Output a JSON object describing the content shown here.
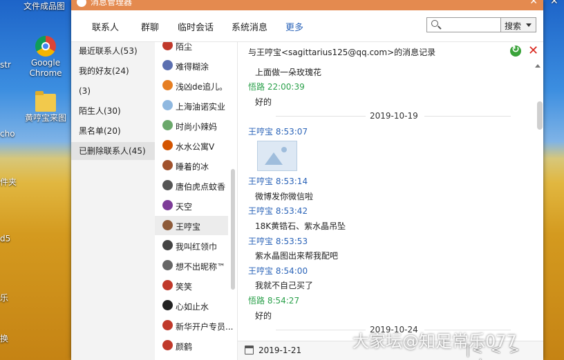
{
  "desktop": {
    "icons": [
      {
        "label": "文件成品图"
      },
      {
        "label": "Google Chrome"
      },
      {
        "label": "黄哼宝来图"
      }
    ],
    "edge_labels": [
      "str",
      "cho",
      "件夹",
      "d5",
      "乐",
      "换"
    ]
  },
  "window": {
    "title": "消息管理器",
    "tabs": [
      {
        "label": "联系人"
      },
      {
        "label": "群聊"
      },
      {
        "label": "临时会话"
      },
      {
        "label": "系统消息"
      },
      {
        "label": "更多"
      }
    ],
    "search": {
      "placeholder": "",
      "button_label": "搜索"
    }
  },
  "categories": [
    {
      "label": "最近联系人(53)"
    },
    {
      "label": "我的好友(24)"
    },
    {
      "label": "(3)"
    },
    {
      "label": "陌生人(30)"
    },
    {
      "label": "黑名单(20)"
    },
    {
      "label": "已删除联系人(45)"
    }
  ],
  "contacts": [
    {
      "name": "陌尘",
      "color": "#c0392b"
    },
    {
      "name": "难得糊涂",
      "color": "#5b6fb0"
    },
    {
      "name": "浅凶de追儿。",
      "color": "#e67e22"
    },
    {
      "name": "上海油诺实业",
      "color": "#8fb8e0"
    },
    {
      "name": "时尚小辣妈",
      "color": "#6aa86a"
    },
    {
      "name": "水水公寓V",
      "color": "#d35400"
    },
    {
      "name": "睡着的冰",
      "color": "#a0522d"
    },
    {
      "name": "唐伯虎点蚊香",
      "color": "#555555"
    },
    {
      "name": "天空",
      "color": "#7d3c98"
    },
    {
      "name": "王哼宝",
      "color": "#8e5b3a"
    },
    {
      "name": "我叫红领巾",
      "color": "#444444"
    },
    {
      "name": "想不出昵称™",
      "color": "#666666"
    },
    {
      "name": "笑笑",
      "color": "#c0392b"
    },
    {
      "name": "心如止水",
      "color": "#222222"
    },
    {
      "name": "新华开户专员...",
      "color": "#c0392b"
    },
    {
      "name": "颜鹤",
      "color": "#c0392b"
    }
  ],
  "messages": {
    "header": "与王哼宝<sagittarius125@qq.com>的消息记录",
    "items": [
      {
        "kind": "text",
        "text": "上面做一朵玫瑰花"
      },
      {
        "kind": "sender",
        "who": "self",
        "text": "悟路 22:00:39"
      },
      {
        "kind": "text",
        "text": "好的"
      },
      {
        "kind": "date",
        "text": "2019-10-19"
      },
      {
        "kind": "sender",
        "who": "other",
        "text": "王哼宝 8:53:07"
      },
      {
        "kind": "image"
      },
      {
        "kind": "sender",
        "who": "other",
        "text": "王哼宝 8:53:14"
      },
      {
        "kind": "text",
        "text": "微博发你微信啦"
      },
      {
        "kind": "sender",
        "who": "other",
        "text": "王哼宝 8:53:42"
      },
      {
        "kind": "text",
        "text": "18K黄锆石、紫水晶吊坠"
      },
      {
        "kind": "sender",
        "who": "other",
        "text": "王哼宝 8:53:53"
      },
      {
        "kind": "text",
        "text": "紫水晶图出来帮我配吧"
      },
      {
        "kind": "sender",
        "who": "other",
        "text": "王哼宝 8:54:00"
      },
      {
        "kind": "text",
        "text": "我就不自己买了"
      },
      {
        "kind": "sender",
        "who": "self",
        "text": "悟路 8:54:27"
      },
      {
        "kind": "text",
        "text": "好的"
      },
      {
        "kind": "date",
        "text": "2019-10-24"
      }
    ],
    "footer_date": "2019-1-21",
    "pager": "|< < > >|"
  },
  "watermark": "大家坛@知足常乐077"
}
